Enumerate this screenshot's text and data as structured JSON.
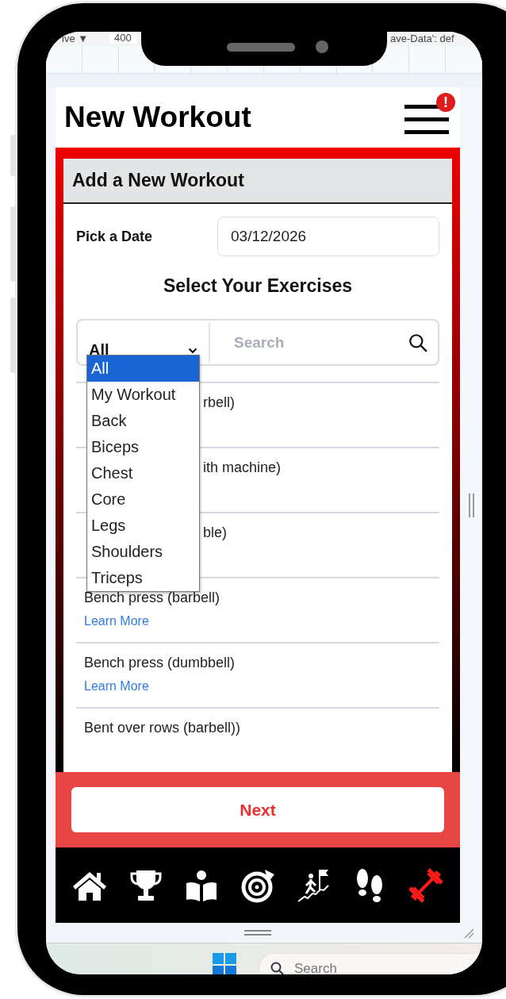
{
  "browser_bar": {
    "left_text": "ive ▼",
    "zoom": "400",
    "right_text": "ave-Data': def"
  },
  "header": {
    "title": "New Workout",
    "badge": "!"
  },
  "card": {
    "title": "Add a New Workout",
    "date_label": "Pick a Date",
    "date_value": "03/12/2026",
    "section_title": "Select Your Exercises"
  },
  "filter": {
    "value": "All",
    "search": {
      "placeholder": "Search"
    },
    "options": [
      {
        "label": "All",
        "selected": true
      },
      {
        "label": "My Workout",
        "selected": false
      },
      {
        "label": "Back",
        "selected": false
      },
      {
        "label": "Biceps",
        "selected": false
      },
      {
        "label": "Chest",
        "selected": false
      },
      {
        "label": "Core",
        "selected": false
      },
      {
        "label": "Legs",
        "selected": false
      },
      {
        "label": "Shoulders",
        "selected": false
      },
      {
        "label": "Triceps",
        "selected": false
      }
    ]
  },
  "exercises": [
    {
      "kind": "partial",
      "name": "rbell)"
    },
    {
      "kind": "partial",
      "name": "ith machine)"
    },
    {
      "kind": "partial",
      "name": "ble)"
    },
    {
      "kind": "full",
      "name": "Bench press (barbell)",
      "link": "Learn More"
    },
    {
      "kind": "full",
      "name": "Bench press (dumbbell)",
      "link": "Learn More"
    },
    {
      "kind": "full",
      "name": "Bent over rows (barbell))"
    }
  ],
  "next_button": "Next",
  "nav": [
    {
      "kind": "home",
      "selected": false
    },
    {
      "kind": "trophy",
      "selected": false
    },
    {
      "kind": "reader",
      "selected": false
    },
    {
      "kind": "target",
      "selected": false
    },
    {
      "kind": "climb",
      "selected": false
    },
    {
      "kind": "footprints",
      "selected": false
    },
    {
      "kind": "dumbbell",
      "selected": true
    }
  ],
  "taskbar": {
    "search": {
      "placeholder": "Search"
    }
  }
}
